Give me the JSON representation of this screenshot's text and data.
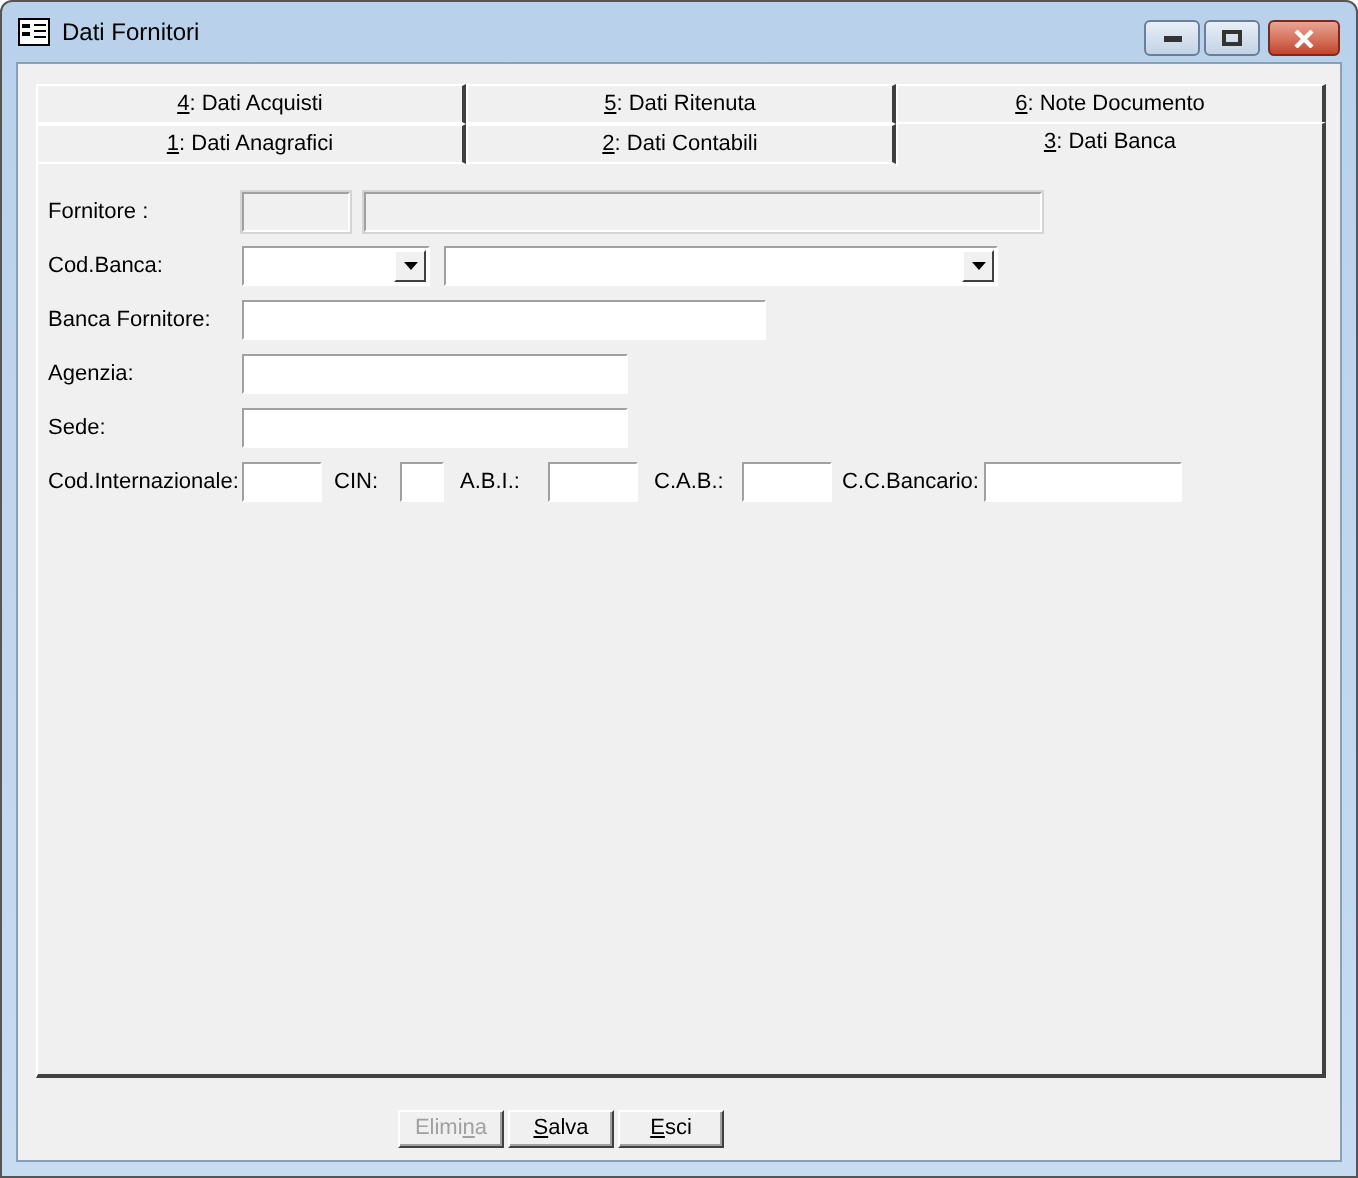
{
  "window": {
    "title": "Dati Fornitori"
  },
  "tab_rows": [
    {
      "tabs": [
        {
          "mnemonic": "4",
          "after": ": Dati Acquisti",
          "selected": false
        },
        {
          "mnemonic": "5",
          "after": ": Dati Ritenuta",
          "selected": false
        },
        {
          "mnemonic": "6",
          "after": ": Note Documento",
          "selected": false
        }
      ]
    },
    {
      "tabs": [
        {
          "mnemonic": "1",
          "after": ": Dati Anagrafici",
          "selected": false
        },
        {
          "mnemonic": "2",
          "after": ": Dati Contabili",
          "selected": false
        },
        {
          "mnemonic": "3",
          "after": ": Dati Banca",
          "selected": true
        }
      ]
    }
  ],
  "form": {
    "fornitore": {
      "label": "Fornitore :",
      "disabled": true
    },
    "cod_banca": {
      "label": "Cod.Banca:"
    },
    "banca_fornitore": {
      "label": "Banca Fornitore:"
    },
    "agenzia": {
      "label": "Agenzia:"
    },
    "sede": {
      "label": "Sede:"
    },
    "coordinates": [
      {
        "label": "Cod.Internazionale:"
      },
      {
        "label": "CIN:"
      },
      {
        "label": "A.B.I.:"
      },
      {
        "label": "C.A.B.:"
      },
      {
        "label": "C.C.Bancario:"
      }
    ]
  },
  "buttons": [
    {
      "before": "Elimi",
      "mnemonic": "n",
      "after": "a",
      "disabled": true
    },
    {
      "mnemonic": "S",
      "after": "alva",
      "disabled": false
    },
    {
      "mnemonic": "E",
      "after": "sci",
      "disabled": false
    }
  ]
}
